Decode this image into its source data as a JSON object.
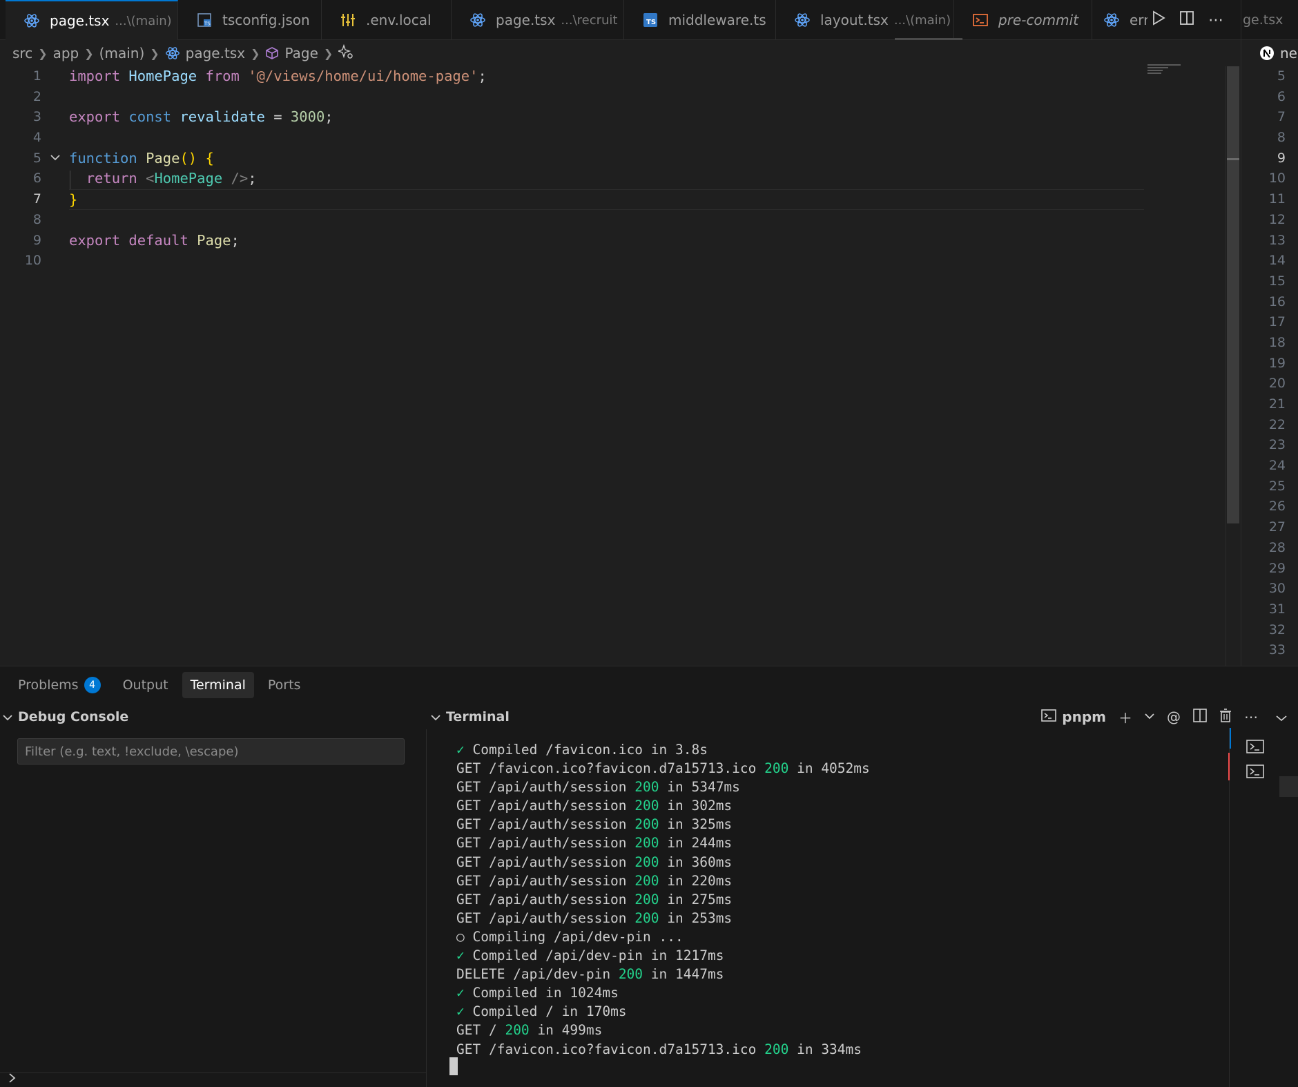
{
  "tabs": [
    {
      "label": "page.tsx",
      "description": "...\\(main)",
      "icon": "react-icon",
      "active": true,
      "close": "✕"
    },
    {
      "label": "tsconfig.json",
      "description": "",
      "icon": "tsconfig-icon"
    },
    {
      "label": ".env.local",
      "description": "",
      "icon": "env-settings-icon"
    },
    {
      "label": "page.tsx",
      "description": "...\\recruit",
      "icon": "react-icon"
    },
    {
      "label": "middleware.ts",
      "description": "",
      "icon": "typescript-icon"
    },
    {
      "label": "layout.tsx",
      "description": "...\\(main)",
      "icon": "react-icon"
    },
    {
      "label": "pre-commit",
      "description": "",
      "icon": "terminal-icon",
      "italic": true
    },
    {
      "label": "err",
      "description": "",
      "icon": "react-icon"
    }
  ],
  "right_tab_overflow": "ge.tsx",
  "breadcrumb": [
    "src",
    "app",
    "(main)",
    "page.tsx",
    "Page"
  ],
  "editor": {
    "current_line": 7,
    "lines": [
      {
        "n": "1"
      },
      {
        "n": "2"
      },
      {
        "n": "3"
      },
      {
        "n": "4"
      },
      {
        "n": "5"
      },
      {
        "n": "6"
      },
      {
        "n": "7"
      },
      {
        "n": "8"
      },
      {
        "n": "9"
      },
      {
        "n": "10"
      }
    ],
    "code": {
      "l1_import": "import",
      "l1_name": "HomePage",
      "l1_from": "from",
      "l1_path": "'@/views/home/ui/home-page'",
      "l1_semi": ";",
      "l3_export": "export",
      "l3_const": "const",
      "l3_name": "revalidate",
      "l3_eq": " = ",
      "l3_val": "3000",
      "l3_semi": ";",
      "l5_function": "function",
      "l5_name": "Page",
      "l5_paren": "()",
      "l5_brace": "{",
      "l6_return": "return",
      "l6_open": "<",
      "l6_comp": "HomePage",
      "l6_close": " />",
      "l6_semi": ";",
      "l7_brace": "}",
      "l9_export": "export",
      "l9_default": "default",
      "l9_name": "Page",
      "l9_semi": ";"
    }
  },
  "right_split": {
    "title": "ne",
    "line_numbers": [
      "5",
      "6",
      "7",
      "8",
      "9",
      "10",
      "11",
      "12",
      "13",
      "14",
      "15",
      "16",
      "17",
      "18",
      "19",
      "20",
      "21",
      "22",
      "23",
      "24",
      "25",
      "26",
      "27",
      "28",
      "29",
      "30",
      "31",
      "32",
      "33"
    ],
    "current_line": "9"
  },
  "panel": {
    "tabs": [
      {
        "label": "Problems",
        "badge": "4"
      },
      {
        "label": "Output"
      },
      {
        "label": "Terminal",
        "active": true
      },
      {
        "label": "Ports"
      }
    ],
    "debug_console_title": "Debug Console",
    "filter_placeholder": "Filter (e.g. text, !exclude, \\escape)",
    "terminal_title": "Terminal",
    "terminal_profile": "pnpm",
    "terminal_lines": [
      {
        "prefix": "✓",
        "text": " Compiled /favicon.ico in 3.8s"
      },
      {
        "text": "GET /favicon.ico?favicon.d7a15713.ico ",
        "status": "200",
        "rest": " in 4052ms"
      },
      {
        "text": "GET /api/auth/session ",
        "status": "200",
        "rest": " in 5347ms"
      },
      {
        "text": "GET /api/auth/session ",
        "status": "200",
        "rest": " in 302ms"
      },
      {
        "text": "GET /api/auth/session ",
        "status": "200",
        "rest": " in 325ms"
      },
      {
        "text": "GET /api/auth/session ",
        "status": "200",
        "rest": " in 244ms"
      },
      {
        "text": "GET /api/auth/session ",
        "status": "200",
        "rest": " in 360ms"
      },
      {
        "text": "GET /api/auth/session ",
        "status": "200",
        "rest": " in 220ms"
      },
      {
        "text": "GET /api/auth/session ",
        "status": "200",
        "rest": " in 275ms"
      },
      {
        "text": "GET /api/auth/session ",
        "status": "200",
        "rest": " in 253ms"
      },
      {
        "prefix_plain": "○",
        "text": " Compiling /api/dev-pin ..."
      },
      {
        "prefix": "✓",
        "text": " Compiled /api/dev-pin in 1217ms"
      },
      {
        "text": "DELETE /api/dev-pin ",
        "status": "200",
        "rest": " in 1447ms"
      },
      {
        "prefix": "✓",
        "text": " Compiled in 1024ms"
      },
      {
        "prefix": "✓",
        "text": " Compiled / in 170ms"
      },
      {
        "text": "GET / ",
        "status": "200",
        "rest": " in 499ms"
      },
      {
        "text": "GET /favicon.ico?favicon.d7a15713.ico ",
        "status": "200",
        "rest": " in 334ms"
      }
    ]
  },
  "colors": {
    "accent": "#0078d4",
    "success": "#23d18b",
    "editor_bg": "#1f1f1f",
    "panel_bg": "#181818"
  }
}
